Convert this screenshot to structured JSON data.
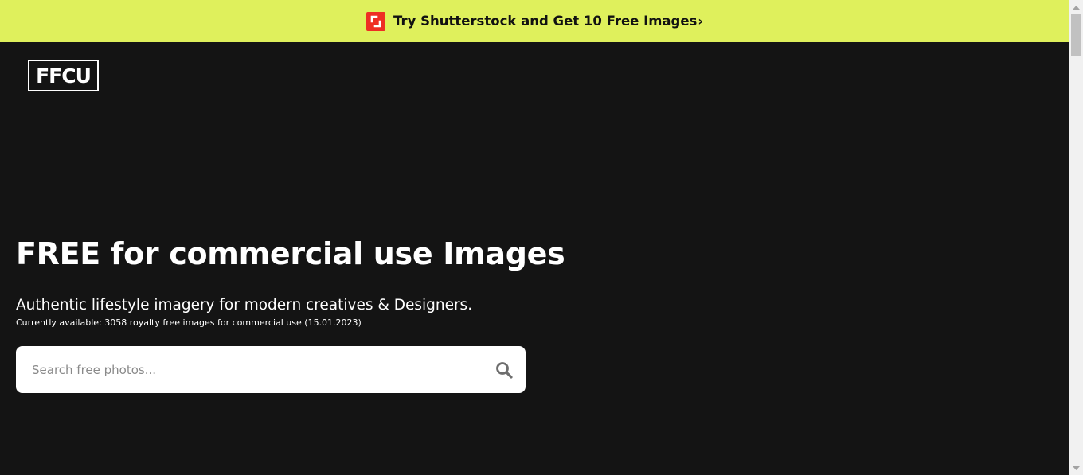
{
  "promo": {
    "text": "Try Shutterstock and Get 10 Free Images",
    "chevron": "›",
    "icon": "shutterstock-logo-icon",
    "background_color": "#dff05c",
    "icon_color": "#ee2e24"
  },
  "logo": {
    "text": "FFCU"
  },
  "hero": {
    "title": "FREE for commercial use Images",
    "subtitle": "Authentic lifestyle imagery for modern creatives & Designers.",
    "availability": "Currently available: 3058 royalty free images for commercial use (15.01.2023)"
  },
  "search": {
    "placeholder": "Search free photos...",
    "value": "",
    "icon": "search-icon"
  },
  "colors": {
    "page_background": "#141414",
    "text": "#ffffff"
  }
}
